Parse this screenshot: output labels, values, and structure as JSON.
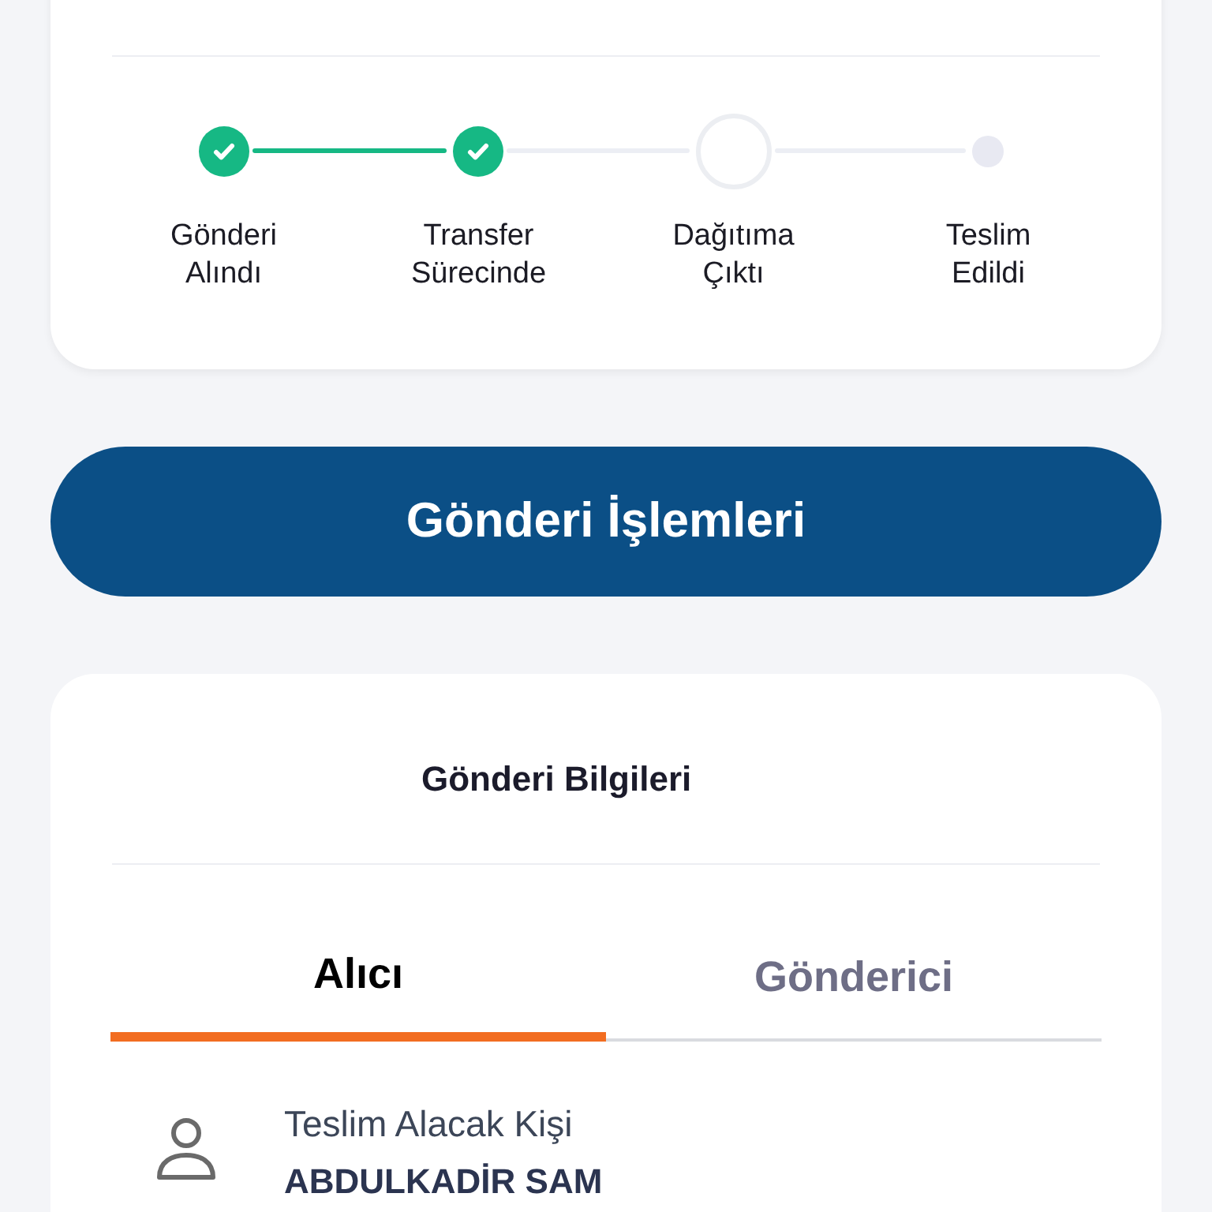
{
  "steps": [
    {
      "label": "Gönderi\nAlındı",
      "completed": true
    },
    {
      "label": "Transfer\nSürecinde",
      "completed": true
    },
    {
      "label": "Dağıtıma\nÇıktı",
      "completed": false
    },
    {
      "label": "Teslim\nEdildi",
      "completed": false
    }
  ],
  "action_button": "Gönderi İşlemleri",
  "info_card": {
    "title": "Gönderi Bilgileri",
    "tabs": [
      {
        "label": "Alıcı",
        "selected": true
      },
      {
        "label": "Gönderici",
        "selected": false
      }
    ],
    "fields": [
      {
        "label": "Teslim Alacak Kişi",
        "value": "ABDULKADİR SAM"
      }
    ]
  }
}
